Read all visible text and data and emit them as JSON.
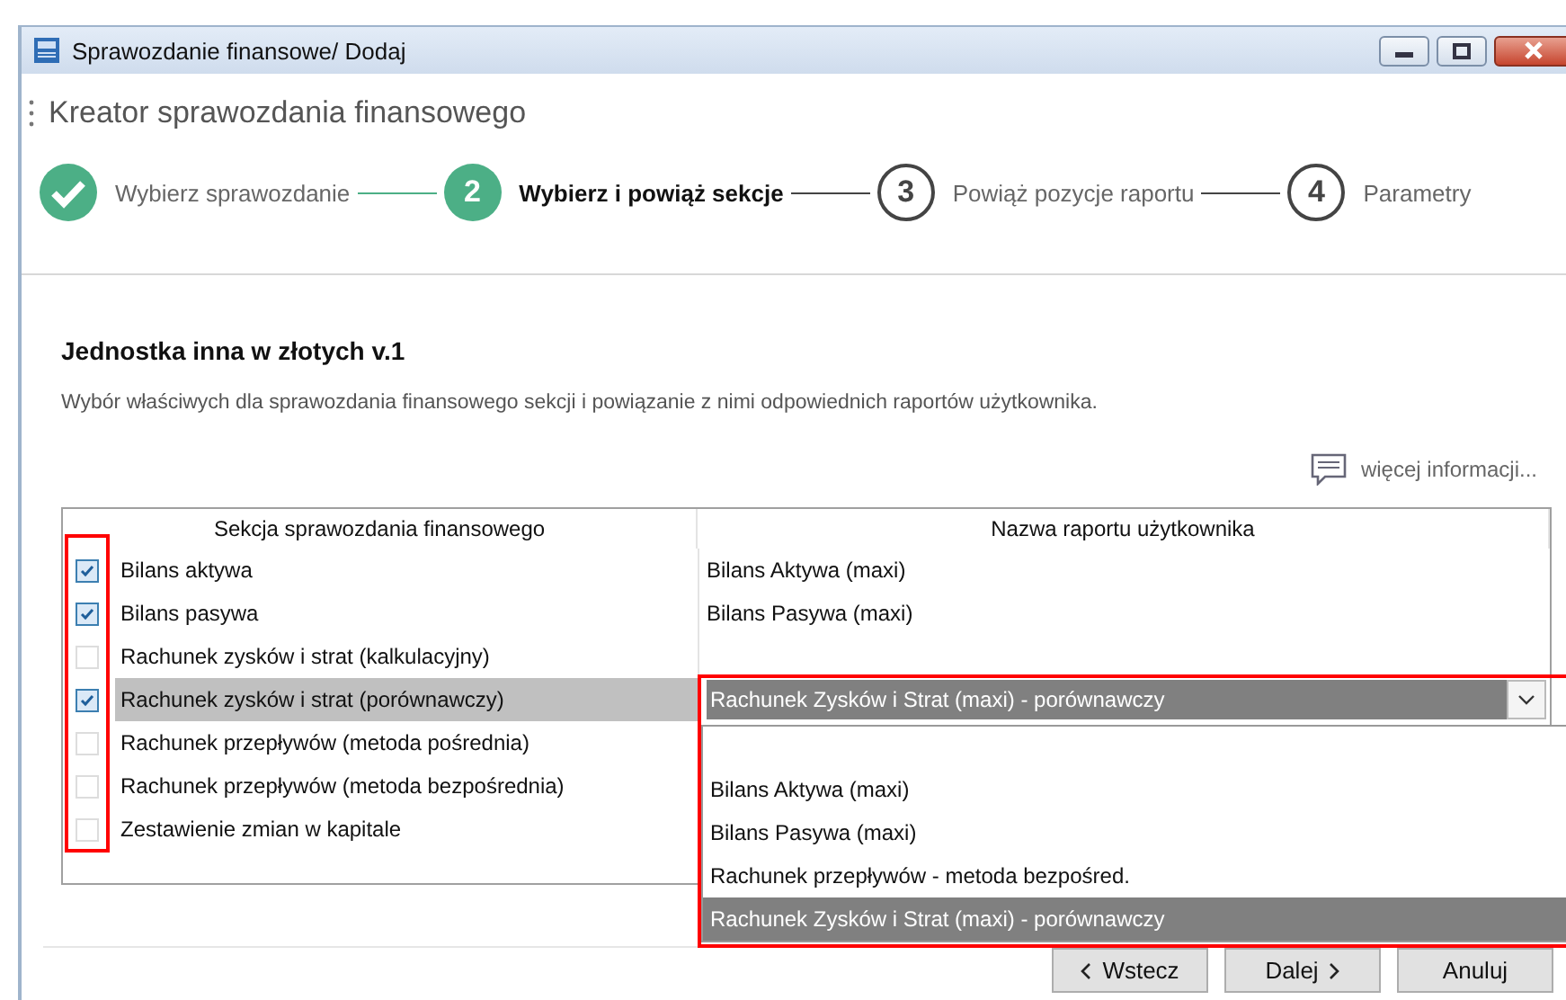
{
  "window": {
    "title": "Sprawozdanie finansowe/ Dodaj"
  },
  "wizard": {
    "title": "Kreator sprawozdania finansowego",
    "steps": [
      {
        "label": "Wybierz sprawozdanie",
        "completed": true,
        "selected": false
      },
      {
        "number": "2",
        "label": "Wybierz i powiąż sekcje",
        "completed": false,
        "selected": true
      },
      {
        "number": "3",
        "label": "Powiąż pozycje raportu",
        "completed": false,
        "selected": false
      },
      {
        "number": "4",
        "label": "Parametry",
        "completed": false,
        "selected": false
      }
    ]
  },
  "heading": "Jednostka inna w złotych v.1",
  "description": "Wybór właściwych dla sprawozdania finansowego sekcji i powiązanie z nimi odpowiednich raportów użytkownika.",
  "more_info_link": "więcej informacji...",
  "table": {
    "checkbox_column_highlighted": true,
    "columns": [
      "Sekcja sprawozdania finansowego",
      "Nazwa raportu użytkownika"
    ],
    "rows": [
      {
        "section": "Bilans aktywa",
        "checked": true,
        "selected": false,
        "report": "Bilans Aktywa (maxi)"
      },
      {
        "section": "Bilans pasywa",
        "checked": true,
        "selected": false,
        "report": "Bilans Pasywa (maxi)"
      },
      {
        "section": "Rachunek zysków i strat (kalkulacyjny)",
        "checked": false,
        "selected": false
      },
      {
        "section": "Rachunek zysków i strat (porównawczy)",
        "checked": true,
        "selected": true,
        "report": "Rachunek Zysków i Strat (maxi) - porównawczy"
      },
      {
        "section": "Rachunek przepływów (metoda pośrednia)",
        "checked": false,
        "selected": false
      },
      {
        "section": "Rachunek przepływów (metoda bezpośrednia)",
        "checked": false,
        "selected": false
      },
      {
        "section": "Zestawienie zmian w kapitale",
        "checked": false,
        "selected": false
      }
    ]
  },
  "dropdown_list": {
    "highlighted": true,
    "options": [
      {
        "label": "Bilans Aktywa (maxi)",
        "selected": false
      },
      {
        "label": "Bilans Pasywa (maxi)",
        "selected": false
      },
      {
        "label": "Rachunek przepływów - metoda bezpośred.",
        "selected": false
      },
      {
        "label": "Rachunek Zysków i Strat (maxi) - porównawczy",
        "selected": true
      }
    ]
  },
  "buttons": [
    {
      "label": "Wstecz",
      "kind": "back"
    },
    {
      "label": "Dalej",
      "kind": "next"
    },
    {
      "label": "Anuluj",
      "kind": "plain"
    }
  ]
}
